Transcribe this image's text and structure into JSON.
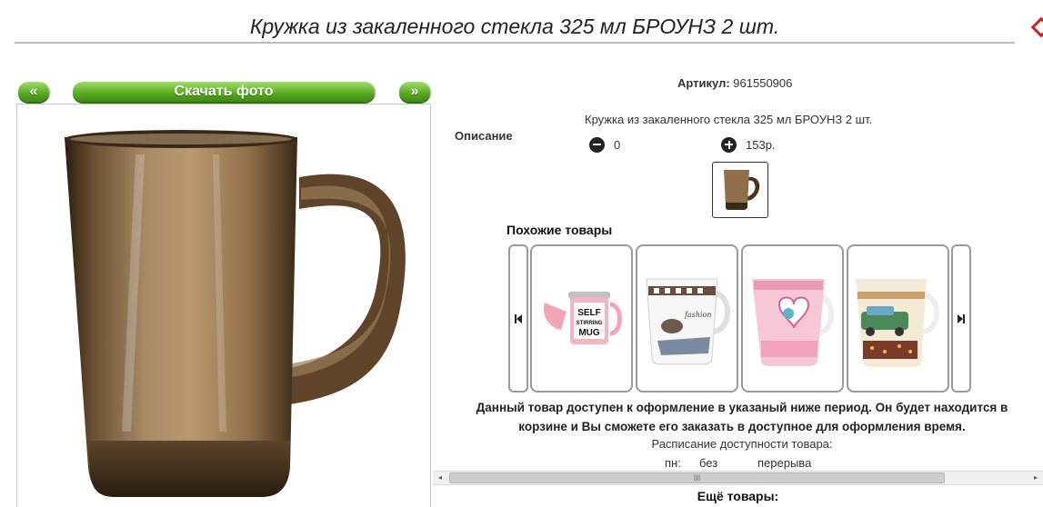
{
  "header": {
    "title": "Кружка из закаленного стекла 325 мл БРОУНЗ 2 шт."
  },
  "gallery": {
    "prev_label": "«",
    "download_label": "Скачать фото",
    "next_label": "»"
  },
  "product": {
    "sku_label": "Артикул:",
    "sku_value": "961550906",
    "description_label": "Описание",
    "description_text": "Кружка из закаленного стекла 325 мл БРОУНЗ 2 шт.",
    "quantity_value": "0",
    "price_value": "153р."
  },
  "similar": {
    "title": "Похожие товары",
    "cards": [
      {
        "label_lines": [
          "SELF",
          "STIRRING",
          "MUG"
        ]
      },
      {
        "label": "fashion"
      },
      {
        "label": ""
      },
      {
        "label": ""
      }
    ]
  },
  "availability": {
    "notice_line1": "Данный товар доступен к оформление в указаный ниже период. Он будет находится в",
    "notice_line2": "корзине и Вы сможете его заказать в доступное для оформления время.",
    "schedule_label": "Расписание доступности товара:",
    "day": "пн:",
    "no": "без",
    "break": "перерыва"
  },
  "scrollbar": {
    "left_arrow": "◂",
    "right_arrow": "▸",
    "grip": "III"
  },
  "more": {
    "title": "Ещё товары:"
  },
  "colors": {
    "button_green": "#56a81f",
    "glass_brown": "#8a6a44"
  }
}
